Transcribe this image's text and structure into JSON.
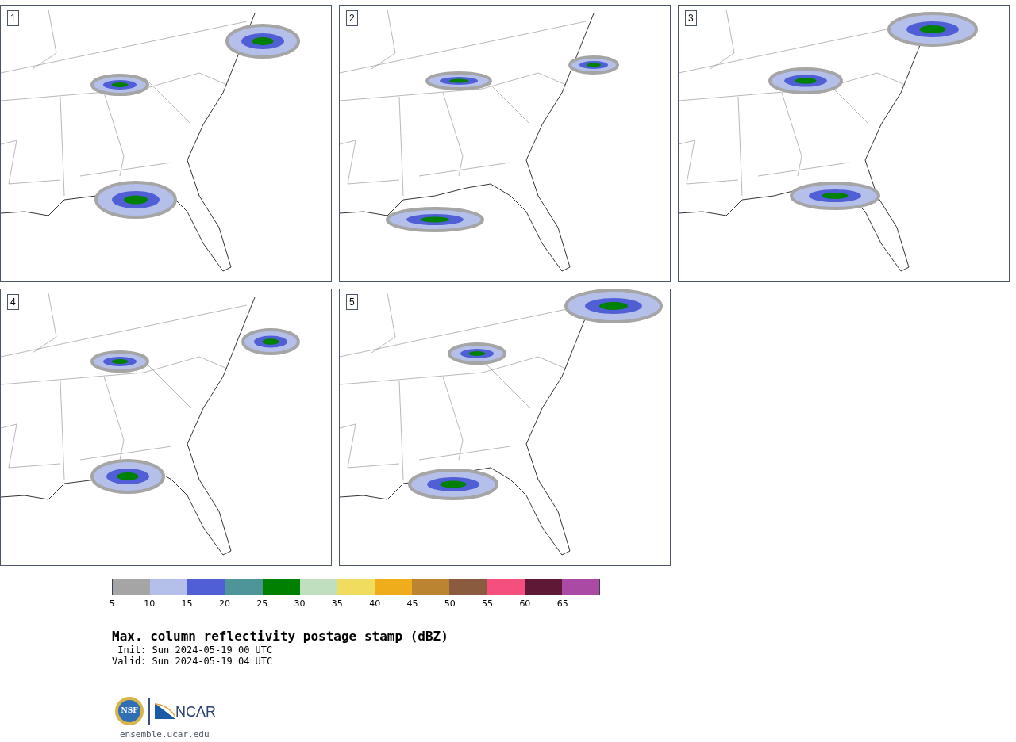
{
  "panels": [
    {
      "label": "1"
    },
    {
      "label": "2"
    },
    {
      "label": "3"
    },
    {
      "label": "4"
    },
    {
      "label": "5"
    }
  ],
  "colorbar": {
    "segments": [
      {
        "color": "#a5a5a5"
      },
      {
        "color": "#b4bfea"
      },
      {
        "color": "#505fd5"
      },
      {
        "color": "#4d9599"
      },
      {
        "color": "#008000"
      },
      {
        "color": "#bfdfbf"
      },
      {
        "color": "#f0dc5f"
      },
      {
        "color": "#f0ad1b"
      },
      {
        "color": "#bb8431"
      },
      {
        "color": "#8b5b3f"
      },
      {
        "color": "#f5507d"
      },
      {
        "color": "#5f1835"
      },
      {
        "color": "#ab4aa5"
      }
    ],
    "ticks": [
      "5",
      "10",
      "15",
      "20",
      "25",
      "30",
      "35",
      "40",
      "45",
      "50",
      "55",
      "60",
      "65"
    ]
  },
  "title": "Max. column reflectivity postage stamp (dBZ)",
  "init": "Init: Sun 2024-05-19 00 UTC",
  "valid": "Valid: Sun 2024-05-19 04 UTC",
  "logos": {
    "seal_text": "NSF",
    "wordmark": "NCAR"
  },
  "url": "ensemble.ucar.edu"
}
